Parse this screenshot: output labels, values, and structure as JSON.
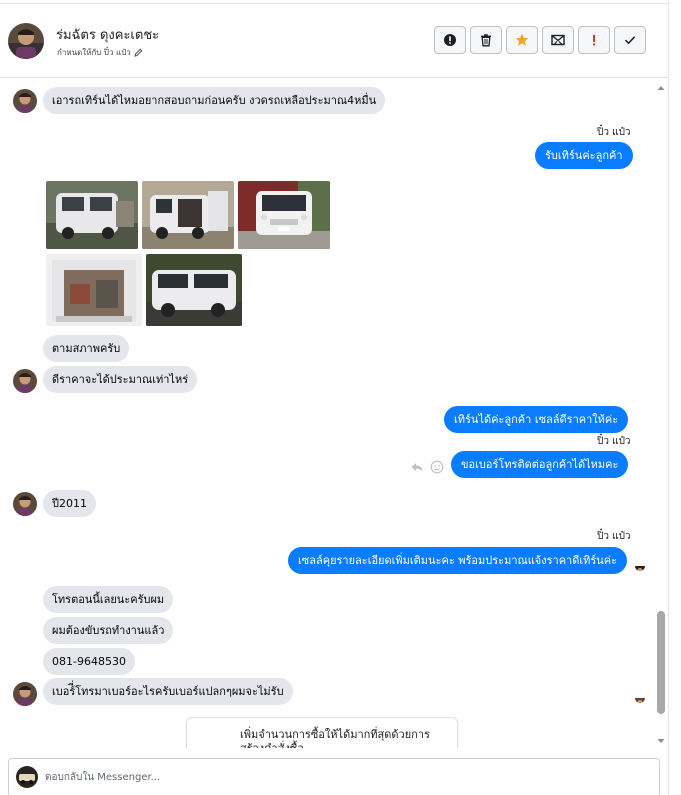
{
  "header": {
    "name": "ร่มฉัตร ดุงคะเตชะ",
    "assigned": "กำหนดให้กับ ปิ๋ว แป๋ว",
    "actions": [
      {
        "icon": "alert-circle-icon"
      },
      {
        "icon": "trash-icon"
      },
      {
        "icon": "star-icon"
      },
      {
        "icon": "mail-x-icon"
      },
      {
        "icon": "exclamation-icon"
      },
      {
        "icon": "check-icon"
      }
    ]
  },
  "messages": {
    "m1": "เอารถเทิร์นได้ไหมอยากสอบถามก่อนครับ งวดรถเหลือประมาณ4หมื่น",
    "s1": "ปิ๋ว แป๋ว",
    "m2": "รับเทิร์นค่ะลูกค้า",
    "m3": "ตามสภาพครับ",
    "m4": "ดีราคาจะได้ประมาณเท่าไหร่",
    "m5": "เทิร์นได้ค่ะลูกค้า  เซลล์ดีราคาให้ค่ะ",
    "s2": "ปิ๋ว แป๋ว",
    "m6": "ขอเบอร์โทรติดต่อลูกค้าได้ไหมคะ",
    "m7": "ปี2011",
    "s3": "ปิ๋ว แป๋ว",
    "m8": "เซลล์คุยรายละเอียดเพิ่มเติมนะคะ  พร้อมประมาณแจ้งราคาดีเทิร์นค่ะ",
    "m9": "โทรตอนนี้เลยนะครับผม",
    "m10": "ผมต้องขับรถทำงานแล้ว",
    "m11": "081-9648530",
    "m12": "เบอร์ี่โทรมาเบอร์อะไรครับเบอร์แปลกๆผมจะไม่รับ"
  },
  "promo_card": {
    "text": "เพิ่มจำนวนการซื้อให้ได้มากที่สุดด้วยการสร้างคำสั่งซื้อ"
  },
  "composer": {
    "placeholder": "ตอบกลับใน Messenger..."
  },
  "colors": {
    "outgoing": "#0a7cff",
    "incoming": "#e4e6eb",
    "star": "#f5a623",
    "exclamation": "#e4362c"
  }
}
